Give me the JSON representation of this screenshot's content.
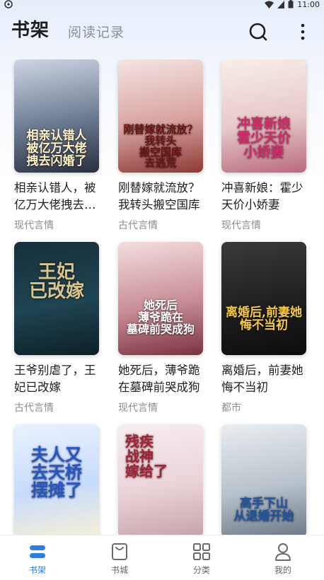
{
  "status_bar": {
    "time": "11:00"
  },
  "header": {
    "tab_active": "书架",
    "tab_inactive": "阅读记录",
    "search_icon": "search-icon",
    "more_icon": "more-vertical-icon"
  },
  "books": [
    {
      "title": "相亲认错人，被亿万大佬拽去闪婚了",
      "category": "现代言情",
      "cover_text": "相亲认错人\n被亿万大佬\n拽去闪婚了",
      "cover_colors": [
        "#cfd6e4",
        "#6d7b92",
        "#2a2f3f"
      ],
      "cover_text_color": "#fff3c4"
    },
    {
      "title": "刚替嫁就流放？我转头搬空国库",
      "category": "古代言情",
      "cover_text": "刚替嫁就流放？我转头\n搬空国库\n去逃荒",
      "cover_colors": [
        "#f4e4e2",
        "#d8a3a0",
        "#8e3a34"
      ],
      "cover_text_color": "#6b1410"
    },
    {
      "title": "冲喜新娘：霍少天价小娇妻",
      "category": "现代言情",
      "cover_text": "冲喜新娘\n霍少天价\n小娇妻",
      "cover_colors": [
        "#f7efe9",
        "#e7c8c8",
        "#b96a7e"
      ],
      "cover_text_color": "#d8286b"
    },
    {
      "title": "王爷别虐了，王妃已改嫁",
      "category": "古代言情",
      "cover_text": "王妃\n已改嫁",
      "cover_colors": [
        "#16303a",
        "#1f4452",
        "#0d1f27"
      ],
      "cover_text_color": "#d9c58a"
    },
    {
      "title": "她死后，薄爷跪在墓碑前哭成狗",
      "category": "现代言情",
      "cover_text": "她死后\n薄爷跪在\n墓碑前哭成狗",
      "cover_colors": [
        "#f3dee0",
        "#c98e97",
        "#7a3340"
      ],
      "cover_text_color": "#ffffff"
    },
    {
      "title": "离婚后，前妻她悔不当初",
      "category": "都市",
      "cover_text": "离婚后,前妻她\n悔不当初",
      "cover_colors": [
        "#3a3a3a",
        "#1f1f1f",
        "#0c0c0c"
      ],
      "cover_text_color": "#f6c945"
    },
    {
      "title": "",
      "category": "",
      "cover_text": "夫人又\n去天桥\n摆摊了",
      "cover_colors": [
        "#eaf2ff",
        "#c7dbfb",
        "#f7f0d8"
      ],
      "cover_text_color": "#2357c8"
    },
    {
      "title": "",
      "category": "",
      "cover_text": "残疾\n战神\n嫁给了",
      "cover_colors": [
        "#f7eef0",
        "#ead3d8",
        "#c6a2ab"
      ],
      "cover_text_color": "#a81e33"
    },
    {
      "title": "",
      "category": "",
      "cover_text": "高手下山\n从退婚开始",
      "cover_colors": [
        "#e9edf0",
        "#b9c3cb",
        "#6b7885"
      ],
      "cover_text_color": "#1d56a8"
    }
  ],
  "bottom_nav": [
    {
      "label": "书架",
      "icon": "bookshelf-icon",
      "active": true
    },
    {
      "label": "书城",
      "icon": "store-bag-icon",
      "active": false
    },
    {
      "label": "分类",
      "icon": "grid-category-icon",
      "active": false
    },
    {
      "label": "我的",
      "icon": "profile-icon",
      "active": false
    }
  ],
  "colors": {
    "accent": "#2b7de9",
    "text": "#1e1e1e",
    "muted": "#8c8c8c"
  }
}
